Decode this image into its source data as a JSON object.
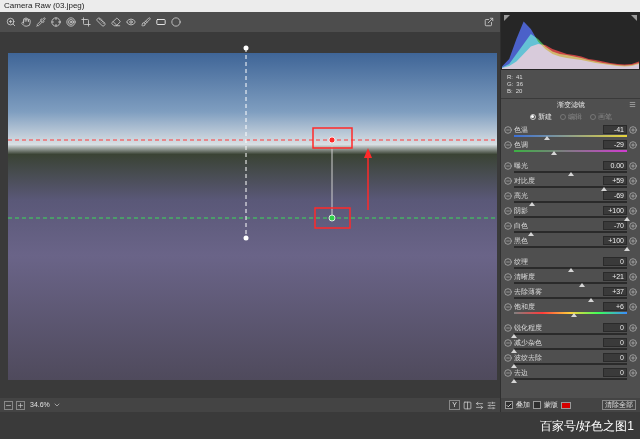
{
  "window": {
    "title": "Camera Raw (03.jpeg)"
  },
  "histogram": {
    "series": [
      {
        "name": "blue",
        "color": "#3a5cff",
        "values": [
          5,
          20,
          60,
          95,
          80,
          55,
          40,
          30,
          25,
          22,
          20,
          18,
          15,
          12,
          10,
          8,
          6,
          5,
          6,
          10
        ]
      },
      {
        "name": "green",
        "color": "#2fd04a",
        "values": [
          3,
          10,
          30,
          50,
          70,
          60,
          45,
          35,
          30,
          28,
          25,
          22,
          18,
          15,
          12,
          10,
          8,
          7,
          8,
          12
        ]
      },
      {
        "name": "red",
        "color": "#ff3030",
        "values": [
          2,
          6,
          15,
          30,
          45,
          50,
          48,
          40,
          35,
          30,
          28,
          25,
          20,
          18,
          15,
          12,
          10,
          9,
          10,
          15
        ]
      }
    ],
    "readout": [
      {
        "label": "R:",
        "value": "41"
      },
      {
        "label": "G:",
        "value": "36"
      },
      {
        "label": "B:",
        "value": "20"
      }
    ]
  },
  "panel": {
    "title": "渐变滤镜",
    "modes": [
      {
        "label": "新建",
        "selected": true,
        "disabled": false
      },
      {
        "label": "编辑",
        "selected": false,
        "disabled": true
      },
      {
        "label": "画笔",
        "selected": false,
        "disabled": true
      }
    ]
  },
  "groups": [
    [
      {
        "label": "色温",
        "value": "-41",
        "level": 0.295,
        "kind": "temperature"
      },
      {
        "label": "色调",
        "value": "-29",
        "level": 0.355,
        "kind": "tint"
      }
    ],
    [
      {
        "label": "曝光",
        "value": "0.00",
        "level": 0.5,
        "kind": "plain"
      },
      {
        "label": "对比度",
        "value": "+59",
        "level": 0.795,
        "kind": "plain"
      },
      {
        "label": "高光",
        "value": "-69",
        "level": 0.155,
        "kind": "plain"
      },
      {
        "label": "阴影",
        "value": "+100",
        "level": 1,
        "kind": "plain"
      },
      {
        "label": "白色",
        "value": "-70",
        "level": 0.15,
        "kind": "plain"
      },
      {
        "label": "黑色",
        "value": "+100",
        "level": 1,
        "kind": "plain"
      }
    ],
    [
      {
        "label": "纹理",
        "value": "0",
        "level": 0.5,
        "kind": "plain"
      },
      {
        "label": "清晰度",
        "value": "+21",
        "level": 0.605,
        "kind": "plain"
      },
      {
        "label": "去除薄雾",
        "value": "+37",
        "level": 0.685,
        "kind": "plain"
      },
      {
        "label": "饱和度",
        "value": "+6",
        "level": 0.53,
        "kind": "saturation"
      }
    ],
    [
      {
        "label": "锐化程度",
        "value": "0",
        "level": 0,
        "kind": "plain"
      },
      {
        "label": "减少杂色",
        "value": "0",
        "level": 0,
        "kind": "plain"
      },
      {
        "label": "波纹去除",
        "value": "0",
        "level": 0,
        "kind": "plain"
      },
      {
        "label": "去边",
        "value": "0",
        "level": 0,
        "kind": "plain"
      }
    ]
  ],
  "overlay_controls": {
    "overlay": {
      "label": "叠加",
      "checked": true
    },
    "mask": {
      "label": "蒙版",
      "checked": false
    },
    "overlay_color": "#d40000",
    "clear_button": "清除全部"
  },
  "zoom": {
    "value": "34.6%"
  },
  "view_controls": [
    "Y"
  ],
  "watermark": "百家号/好色之图1"
}
